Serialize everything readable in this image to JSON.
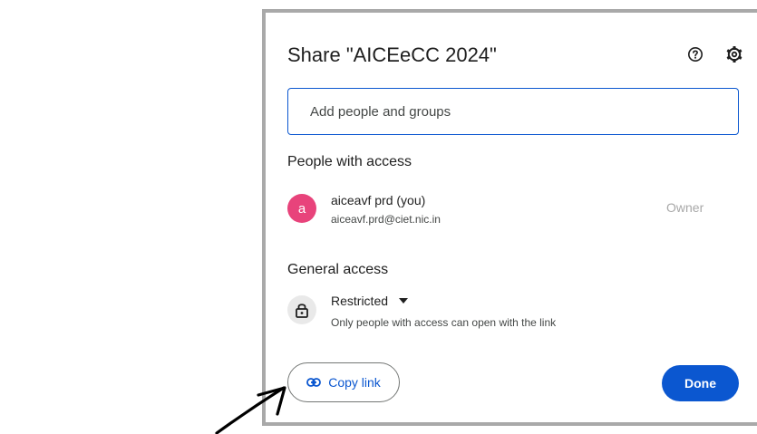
{
  "dialog": {
    "title": "Share \"AICEeCC 2024\"",
    "help_icon": "help-circle-icon",
    "settings_icon": "gear-icon"
  },
  "add_people": {
    "placeholder": "Add people and groups",
    "value": ""
  },
  "people_with_access": {
    "heading": "People with access",
    "users": [
      {
        "avatar_letter": "a",
        "avatar_color": "#e8437b",
        "name": "aiceavf prd (you)",
        "email": "aiceavf.prd@ciet.nic.in",
        "role": "Owner"
      }
    ]
  },
  "general_access": {
    "heading": "General access",
    "lock_icon": "lock-icon",
    "selected": "Restricted",
    "description": "Only people with access can open with the link"
  },
  "footer": {
    "copy_link_label": "Copy link",
    "copy_link_icon": "link-icon",
    "done_label": "Done"
  },
  "colors": {
    "accent": "#0b57d0",
    "frame_border": "#a9a9a9",
    "owner_text": "#a8a8a8"
  }
}
